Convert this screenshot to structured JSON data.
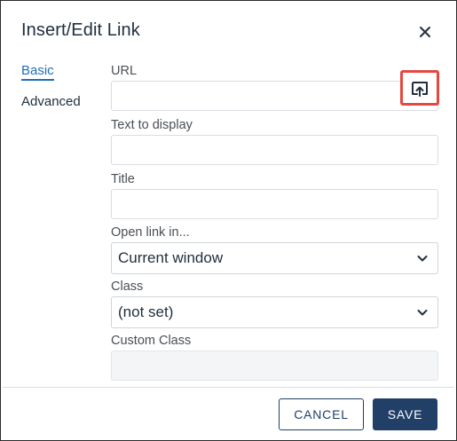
{
  "dialog": {
    "title": "Insert/Edit Link",
    "close_icon": "close-icon"
  },
  "tabs": [
    {
      "label": "Basic",
      "active": true
    },
    {
      "label": "Advanced",
      "active": false
    }
  ],
  "form": {
    "url": {
      "label": "URL",
      "value": "",
      "browse_icon": "browse-link-icon"
    },
    "text": {
      "label": "Text to display",
      "value": ""
    },
    "title": {
      "label": "Title",
      "value": ""
    },
    "open_in": {
      "label": "Open link in...",
      "selected": "Current window"
    },
    "class": {
      "label": "Class",
      "selected": "(not set)"
    },
    "custom_class": {
      "label": "Custom Class",
      "value": "",
      "disabled": true
    }
  },
  "footer": {
    "cancel_label": "CANCEL",
    "save_label": "SAVE"
  },
  "colors": {
    "accent": "#1f6fb5",
    "primary_button": "#213f67",
    "highlight": "#e5483f"
  }
}
